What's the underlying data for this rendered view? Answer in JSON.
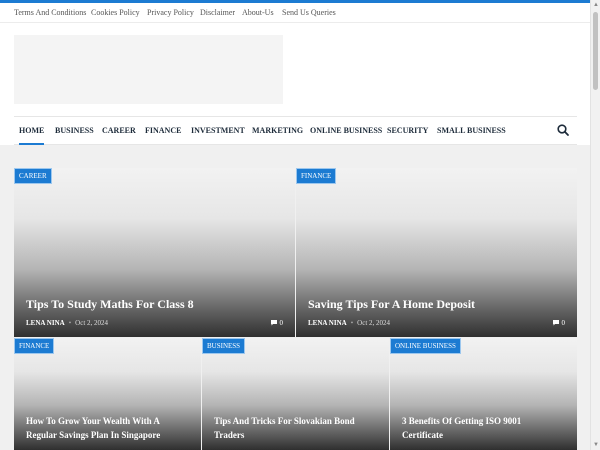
{
  "topbar": {
    "links": [
      "Terms And Conditions",
      "Cookies Policy",
      "Privacy Policy",
      "Disclaimer",
      "About-Us",
      "Send Us Queries"
    ]
  },
  "nav": {
    "items": [
      "HOME",
      "BUSINESS",
      "CAREER",
      "FINANCE",
      "INVESTMENT",
      "MARKETING",
      "ONLINE BUSINESS",
      "SECURITY",
      "SMALL BUSINESS"
    ],
    "active": "HOME",
    "search_icon": "search-icon"
  },
  "featured": [
    {
      "category": "CAREER",
      "title": "Tips To Study Maths For Class 8",
      "author": "LENA NINA",
      "date": "Oct 2, 2024",
      "comments": "0"
    },
    {
      "category": "FINANCE",
      "title": "Saving Tips For A Home Deposit",
      "author": "LENA NINA",
      "date": "Oct 2, 2024",
      "comments": "0"
    }
  ],
  "secondary": [
    {
      "category": "FINANCE",
      "title": "How To Grow Your Wealth With A Regular Savings Plan In Singapore"
    },
    {
      "category": "BUSINESS",
      "title": "Tips And Tricks For Slovakian Bond Traders"
    },
    {
      "category": "ONLINE BUSINESS",
      "title": "3 Benefits Of Getting ISO 9001 Certificate"
    }
  ],
  "colors": {
    "accent": "#1c7bd2"
  }
}
